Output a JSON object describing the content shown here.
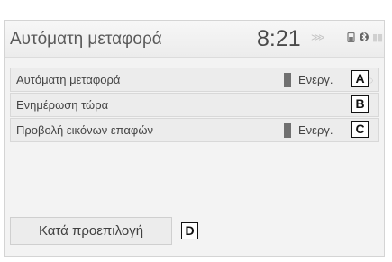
{
  "header": {
    "title": "Αυτόματη μεταφορά",
    "clock": "8:21"
  },
  "rows": [
    {
      "label": "Αυτόματη μεταφορά",
      "value": "Ενεργ.",
      "callout": "A"
    },
    {
      "label": "Ενημέρωση τώρα",
      "callout": "B"
    },
    {
      "label": "Προβολή εικόνων επαφών",
      "value": "Ενεργ.",
      "callout": "C"
    }
  ],
  "default_button": {
    "label": "Κατά προεπιλογή",
    "callout": "D"
  },
  "icons": {
    "status": [
      "phone-icon",
      "battery-icon",
      "bluetooth-icon",
      "signal-icon"
    ]
  },
  "colors": {
    "background": "#f3f3f3",
    "row": "#ececec",
    "toggle_indicator": "#707070"
  }
}
